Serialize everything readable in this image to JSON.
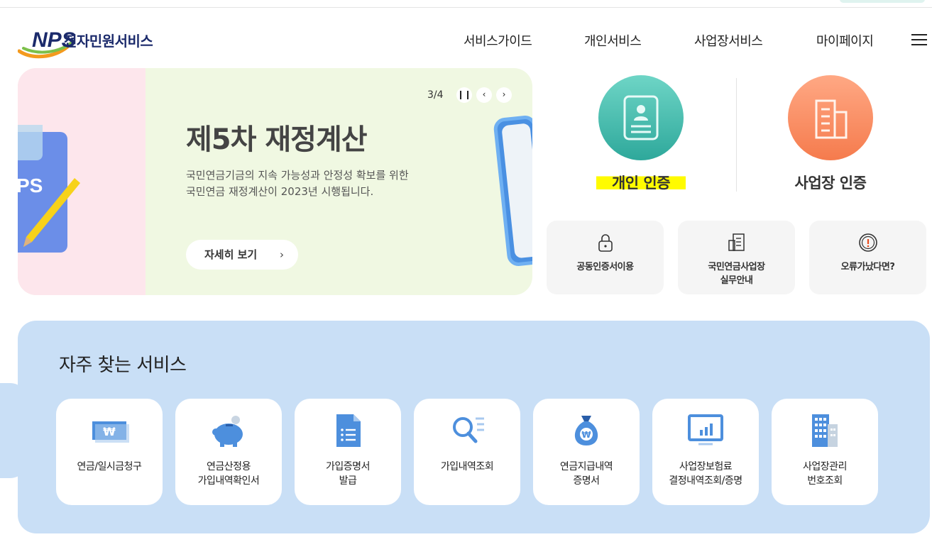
{
  "header": {
    "logo_text": "NPS",
    "service_name": "전자민원서비스",
    "nav": [
      "서비스가이드",
      "개인서비스",
      "사업장서비스",
      "마이페이지"
    ]
  },
  "banner": {
    "page": "3/4",
    "title": "제5차 재정계산",
    "desc_line1": "국민연금기금의 지속 가능성과 안정성 확보를 위한",
    "desc_line2": "국민연금 재정계산이 2023년 시행됩니다.",
    "more_button": "자세히 보기",
    "colors": {
      "left": "#fde6ec",
      "right": "#f0f8e2"
    }
  },
  "auth": {
    "personal": "개인 인증",
    "business": "사업장 인증"
  },
  "quick_links": [
    {
      "line1": "공동인증서이용",
      "line2": "",
      "icon": "lock-icon"
    },
    {
      "line1": "국민연금사업장",
      "line2": "실무안내",
      "icon": "document-icon"
    },
    {
      "line1": "오류가났다면?",
      "line2": "",
      "icon": "alert-icon"
    }
  ],
  "frequent": {
    "title": "자주 찾는 서비스",
    "items": [
      {
        "line1": "연금/일시금청구",
        "line2": "",
        "icon": "won-bill-icon"
      },
      {
        "line1": "연금산정용",
        "line2": "가입내역확인서",
        "icon": "piggy-bank-icon"
      },
      {
        "line1": "가입증명서",
        "line2": "발급",
        "icon": "certificate-doc-icon"
      },
      {
        "line1": "가입내역조회",
        "line2": "",
        "icon": "search-list-icon"
      },
      {
        "line1": "연금지급내역",
        "line2": "증명서",
        "icon": "money-bag-icon"
      },
      {
        "line1": "사업장보험료",
        "line2": "결정내역조회/증명",
        "icon": "monitor-chart-icon"
      },
      {
        "line1": "사업장관리",
        "line2": "번호조회",
        "icon": "building-icon"
      }
    ],
    "accent": "#c9dff6"
  }
}
